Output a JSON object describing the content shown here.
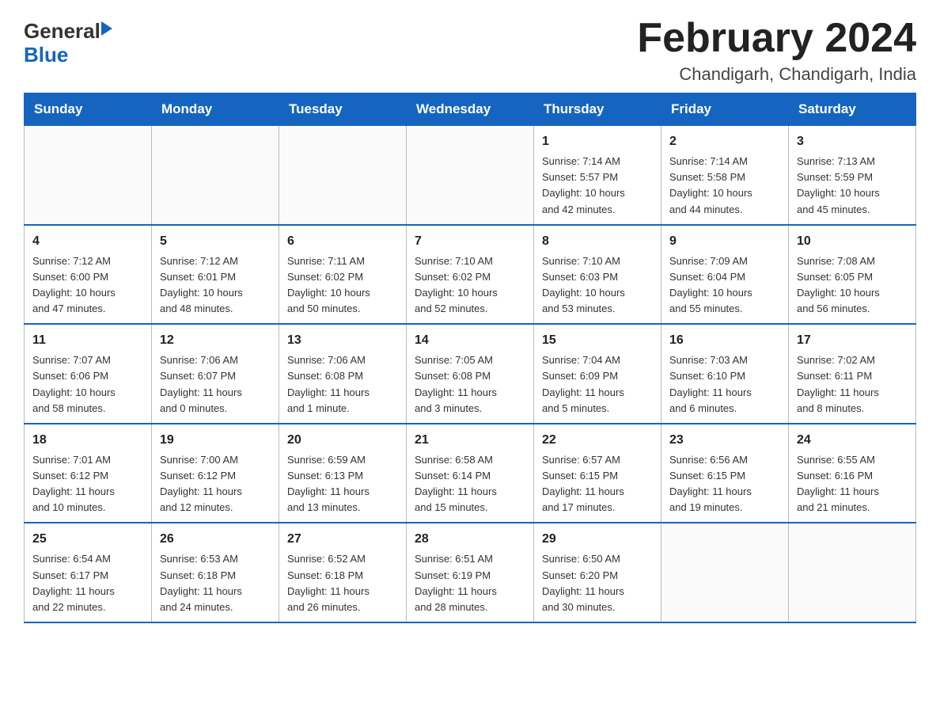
{
  "header": {
    "title": "February 2024",
    "subtitle": "Chandigarh, Chandigarh, India",
    "logo_general": "General",
    "logo_blue": "Blue"
  },
  "weekdays": [
    "Sunday",
    "Monday",
    "Tuesday",
    "Wednesday",
    "Thursday",
    "Friday",
    "Saturday"
  ],
  "weeks": [
    [
      {
        "day": "",
        "info": ""
      },
      {
        "day": "",
        "info": ""
      },
      {
        "day": "",
        "info": ""
      },
      {
        "day": "",
        "info": ""
      },
      {
        "day": "1",
        "info": "Sunrise: 7:14 AM\nSunset: 5:57 PM\nDaylight: 10 hours\nand 42 minutes."
      },
      {
        "day": "2",
        "info": "Sunrise: 7:14 AM\nSunset: 5:58 PM\nDaylight: 10 hours\nand 44 minutes."
      },
      {
        "day": "3",
        "info": "Sunrise: 7:13 AM\nSunset: 5:59 PM\nDaylight: 10 hours\nand 45 minutes."
      }
    ],
    [
      {
        "day": "4",
        "info": "Sunrise: 7:12 AM\nSunset: 6:00 PM\nDaylight: 10 hours\nand 47 minutes."
      },
      {
        "day": "5",
        "info": "Sunrise: 7:12 AM\nSunset: 6:01 PM\nDaylight: 10 hours\nand 48 minutes."
      },
      {
        "day": "6",
        "info": "Sunrise: 7:11 AM\nSunset: 6:02 PM\nDaylight: 10 hours\nand 50 minutes."
      },
      {
        "day": "7",
        "info": "Sunrise: 7:10 AM\nSunset: 6:02 PM\nDaylight: 10 hours\nand 52 minutes."
      },
      {
        "day": "8",
        "info": "Sunrise: 7:10 AM\nSunset: 6:03 PM\nDaylight: 10 hours\nand 53 minutes."
      },
      {
        "day": "9",
        "info": "Sunrise: 7:09 AM\nSunset: 6:04 PM\nDaylight: 10 hours\nand 55 minutes."
      },
      {
        "day": "10",
        "info": "Sunrise: 7:08 AM\nSunset: 6:05 PM\nDaylight: 10 hours\nand 56 minutes."
      }
    ],
    [
      {
        "day": "11",
        "info": "Sunrise: 7:07 AM\nSunset: 6:06 PM\nDaylight: 10 hours\nand 58 minutes."
      },
      {
        "day": "12",
        "info": "Sunrise: 7:06 AM\nSunset: 6:07 PM\nDaylight: 11 hours\nand 0 minutes."
      },
      {
        "day": "13",
        "info": "Sunrise: 7:06 AM\nSunset: 6:08 PM\nDaylight: 11 hours\nand 1 minute."
      },
      {
        "day": "14",
        "info": "Sunrise: 7:05 AM\nSunset: 6:08 PM\nDaylight: 11 hours\nand 3 minutes."
      },
      {
        "day": "15",
        "info": "Sunrise: 7:04 AM\nSunset: 6:09 PM\nDaylight: 11 hours\nand 5 minutes."
      },
      {
        "day": "16",
        "info": "Sunrise: 7:03 AM\nSunset: 6:10 PM\nDaylight: 11 hours\nand 6 minutes."
      },
      {
        "day": "17",
        "info": "Sunrise: 7:02 AM\nSunset: 6:11 PM\nDaylight: 11 hours\nand 8 minutes."
      }
    ],
    [
      {
        "day": "18",
        "info": "Sunrise: 7:01 AM\nSunset: 6:12 PM\nDaylight: 11 hours\nand 10 minutes."
      },
      {
        "day": "19",
        "info": "Sunrise: 7:00 AM\nSunset: 6:12 PM\nDaylight: 11 hours\nand 12 minutes."
      },
      {
        "day": "20",
        "info": "Sunrise: 6:59 AM\nSunset: 6:13 PM\nDaylight: 11 hours\nand 13 minutes."
      },
      {
        "day": "21",
        "info": "Sunrise: 6:58 AM\nSunset: 6:14 PM\nDaylight: 11 hours\nand 15 minutes."
      },
      {
        "day": "22",
        "info": "Sunrise: 6:57 AM\nSunset: 6:15 PM\nDaylight: 11 hours\nand 17 minutes."
      },
      {
        "day": "23",
        "info": "Sunrise: 6:56 AM\nSunset: 6:15 PM\nDaylight: 11 hours\nand 19 minutes."
      },
      {
        "day": "24",
        "info": "Sunrise: 6:55 AM\nSunset: 6:16 PM\nDaylight: 11 hours\nand 21 minutes."
      }
    ],
    [
      {
        "day": "25",
        "info": "Sunrise: 6:54 AM\nSunset: 6:17 PM\nDaylight: 11 hours\nand 22 minutes."
      },
      {
        "day": "26",
        "info": "Sunrise: 6:53 AM\nSunset: 6:18 PM\nDaylight: 11 hours\nand 24 minutes."
      },
      {
        "day": "27",
        "info": "Sunrise: 6:52 AM\nSunset: 6:18 PM\nDaylight: 11 hours\nand 26 minutes."
      },
      {
        "day": "28",
        "info": "Sunrise: 6:51 AM\nSunset: 6:19 PM\nDaylight: 11 hours\nand 28 minutes."
      },
      {
        "day": "29",
        "info": "Sunrise: 6:50 AM\nSunset: 6:20 PM\nDaylight: 11 hours\nand 30 minutes."
      },
      {
        "day": "",
        "info": ""
      },
      {
        "day": "",
        "info": ""
      }
    ]
  ]
}
